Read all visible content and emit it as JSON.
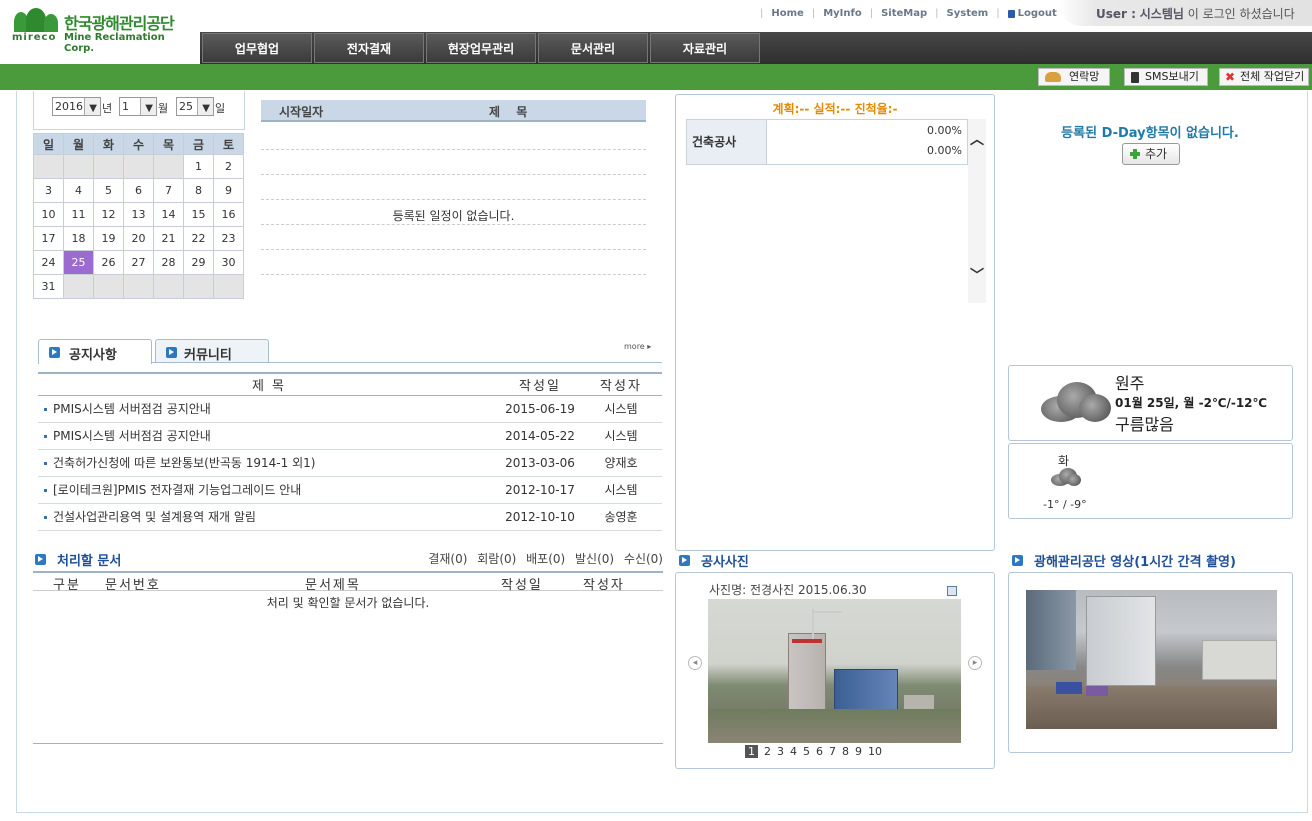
{
  "logo": {
    "ko": "한국광해관리공단",
    "en_mark": "mireco",
    "en": "Mine Reclamation Corp."
  },
  "topnav": {
    "home": "Home",
    "myinfo": "MyInfo",
    "sitemap": "SiteMap",
    "system": "System",
    "logout": "Logout"
  },
  "user": {
    "label": "User :",
    "name": "시스템님",
    "msg": "이 로그인 하셨습니다"
  },
  "menu": [
    "업무협업",
    "전자결재",
    "현장업무관리",
    "문서관리",
    "자료관리"
  ],
  "quick": {
    "contacts": "연락망",
    "sms": "SMS보내기",
    "close_all": "전체 작업닫기"
  },
  "calendar": {
    "year": "2016",
    "year_suffix": "년",
    "month": "1",
    "month_suffix": "월",
    "day": "25",
    "day_suffix": "일",
    "weekdays": [
      "일",
      "월",
      "화",
      "수",
      "목",
      "금",
      "토"
    ],
    "weeks": [
      [
        "",
        "",
        "",
        "",
        "",
        "1",
        "2"
      ],
      [
        "3",
        "4",
        "5",
        "6",
        "7",
        "8",
        "9"
      ],
      [
        "10",
        "11",
        "12",
        "13",
        "14",
        "15",
        "16"
      ],
      [
        "17",
        "18",
        "19",
        "20",
        "21",
        "22",
        "23"
      ],
      [
        "24",
        "25",
        "26",
        "27",
        "28",
        "29",
        "30"
      ],
      [
        "31",
        "",
        "",
        "",
        "",
        "",
        ""
      ]
    ],
    "today": "25"
  },
  "schedule": {
    "col_start": "시작일자",
    "col_title": "제  목",
    "empty": "등록된 일정이 없습니다."
  },
  "notice": {
    "tabs": [
      "공지사항",
      "커뮤니티"
    ],
    "more": "more",
    "headers": [
      "제   목",
      "작성일",
      "작성자"
    ],
    "rows": [
      {
        "title": "PMIS시스템 서버점검 공지안내",
        "date": "2015-06-19",
        "author": "시스템"
      },
      {
        "title": "PMIS시스템 서버점검 공지안내",
        "date": "2014-05-22",
        "author": "시스템"
      },
      {
        "title": "건축허가신청에 따른 보완통보(반곡동 1914-1 외1)",
        "date": "2013-03-06",
        "author": "양재호"
      },
      {
        "title": "[로이테크원]PMIS 전자결재 기능업그레이드 안내",
        "date": "2012-10-17",
        "author": "시스템"
      },
      {
        "title": "건설사업관리용역 및 설계용역 재개 알림",
        "date": "2012-10-10",
        "author": "송영훈"
      }
    ]
  },
  "docs": {
    "title": "처리할 문서",
    "counts": "결재(0) 회람(0) 배포(0) 발신(0) 수신(0)",
    "headers": [
      "구분",
      "문서번호",
      "문서제목",
      "작성일",
      "작성자"
    ],
    "empty": "처리 및 확인할 문서가 없습니다."
  },
  "progress": {
    "title": "계획:-- 실적:-- 진척율:-",
    "category": "건축공사",
    "plan": "0.00%",
    "actual": "0.00%"
  },
  "dday": {
    "empty": "등록된 D-Day항목이 없습니다.",
    "add": "추가"
  },
  "weather": {
    "city": "원주",
    "date": "01월 25일, 월 -2℃/-12℃",
    "desc": "구름많음",
    "next_day": "화",
    "next_temp": "-1° / -9°"
  },
  "photo": {
    "section": "공사사진",
    "caption": "사진명: 전경사진 2015.06.30",
    "pages": [
      "1",
      "2",
      "3",
      "4",
      "5",
      "6",
      "7",
      "8",
      "9",
      "10"
    ],
    "current": "1"
  },
  "video": {
    "section": "광해관리공단 영상(1시간 간격 촬영)"
  },
  "colors": {
    "green": "#4b9b3d",
    "menu": "#3b3b3b",
    "accent_blue": "#1f4f98",
    "today": "#9b6bcf",
    "orange": "#e68a00"
  }
}
